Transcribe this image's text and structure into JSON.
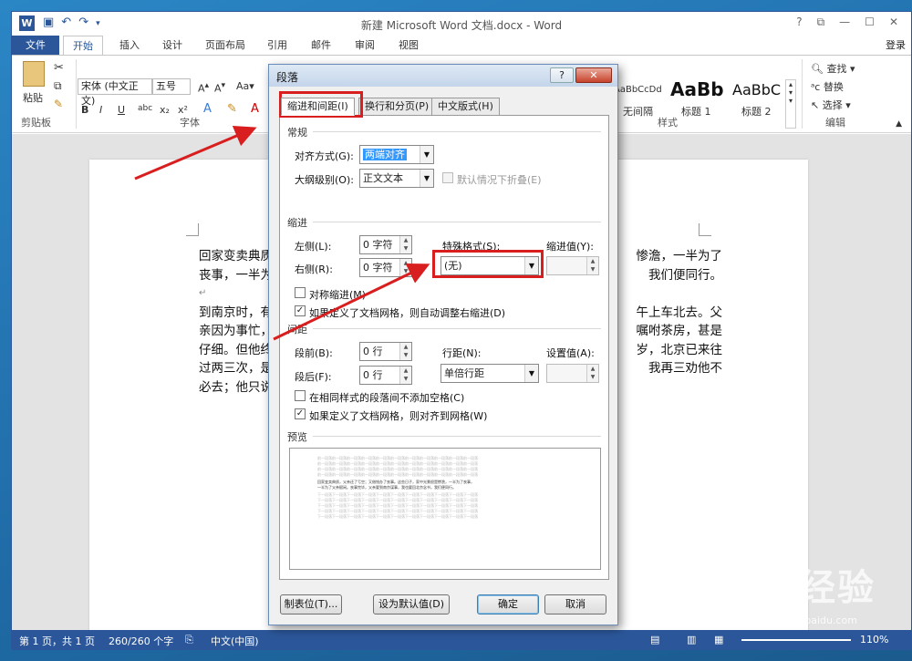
{
  "window": {
    "title": "新建 Microsoft Word 文档.docx - Word",
    "app_icon": "W",
    "controls": [
      "?",
      "⧉",
      "—",
      "☐",
      "✕"
    ]
  },
  "tabs": [
    "文件",
    "开始",
    "插入",
    "设计",
    "页面布局",
    "引用",
    "邮件",
    "审阅",
    "视图"
  ],
  "active_tab": "开始",
  "login": "登录",
  "ribbon": {
    "paste": "粘贴",
    "clipboard_group": "剪贴板",
    "font_name": "宋体 (中文正文)",
    "font_size": "五号",
    "font_group": "字体",
    "bold": "B",
    "italic": "I",
    "underline": "U",
    "styles": [
      {
        "preview": "AaBbCcDd",
        "name": "无间隔"
      },
      {
        "preview": "AaBb",
        "name": "标题 1"
      },
      {
        "preview": "AaBbC",
        "name": "标题 2"
      }
    ],
    "styles_group": "样式",
    "find": "查找",
    "replace": "替换",
    "select": "选择",
    "editing_group": "编辑"
  },
  "document": {
    "lines": [
      "回家变卖典质",
      "丧事，一半为",
      "",
      "到南京时，有",
      "亲因为事忙，",
      "仔细。但他终",
      "过两三次，是",
      "必去；他只说"
    ],
    "right_fragments": [
      "惨澹，一半为了",
      "我们便同行。",
      "",
      "午上车北去。父",
      "嘱咐茶房，甚是",
      "岁，北京已来往",
      "我再三劝他不",
      ""
    ]
  },
  "statusbar": {
    "page": "第 1 页，共 1 页",
    "words": "260/260 个字",
    "language": "中文(中国)",
    "zoom": "110%"
  },
  "dialog": {
    "title": "段落",
    "help": "?",
    "close": "✕",
    "tabs": [
      "缩进和间距(I)",
      "换行和分页(P)",
      "中文版式(H)"
    ],
    "general": {
      "section": "常规",
      "alignment_label": "对齐方式(G):",
      "alignment_value": "两端对齐",
      "outline_label": "大纲级别(O):",
      "outline_value": "正文文本",
      "collapse_label": "默认情况下折叠(E)"
    },
    "indent": {
      "section": "缩进",
      "left_label": "左侧(L):",
      "left_value": "0 字符",
      "right_label": "右侧(R):",
      "right_value": "0 字符",
      "special_label": "特殊格式(S):",
      "special_value": "(无)",
      "by_label": "缩进值(Y):",
      "mirror_label": "对称缩进(M)",
      "auto_adjust_label": "如果定义了文档网格，则自动调整右缩进(D)"
    },
    "spacing": {
      "section": "间距",
      "before_label": "段前(B):",
      "before_value": "0 行",
      "after_label": "段后(F):",
      "after_value": "0 行",
      "line_label": "行距(N):",
      "line_value": "单倍行距",
      "at_label": "设置值(A):",
      "no_space_label": "在相同样式的段落间不添加空格(C)",
      "snap_grid_label": "如果定义了文档网格，则对齐到网格(W)"
    },
    "preview": {
      "section": "预览",
      "prev_text": "前一段落前一段落前一段落前一段落前一段落前一段落前一段落前一段落前一段落前一段落前一段落",
      "sample_1": "回家变卖典质，父亲还了亏空；又借钱办了丧事。这些日子，家中光景很是惨澹，一半为了丧事，",
      "sample_2": "一半为了父亲赋闲。丧事完毕，父亲要到南京谋事，我也要回北京念书，我们便同行。",
      "next_text": "下一段落下一段落下一段落下一段落下一段落下一段落下一段落下一段落下一段落下一段落下一段落"
    },
    "buttons": {
      "tabs": "制表位(T)...",
      "default": "设为默认值(D)",
      "ok": "确定",
      "cancel": "取消"
    }
  },
  "watermark": "Bai du 经验",
  "watermark_url": "jingyan.baidu.com",
  "colors": {
    "word_blue": "#2b579a",
    "callout_red": "#d81e1e"
  }
}
